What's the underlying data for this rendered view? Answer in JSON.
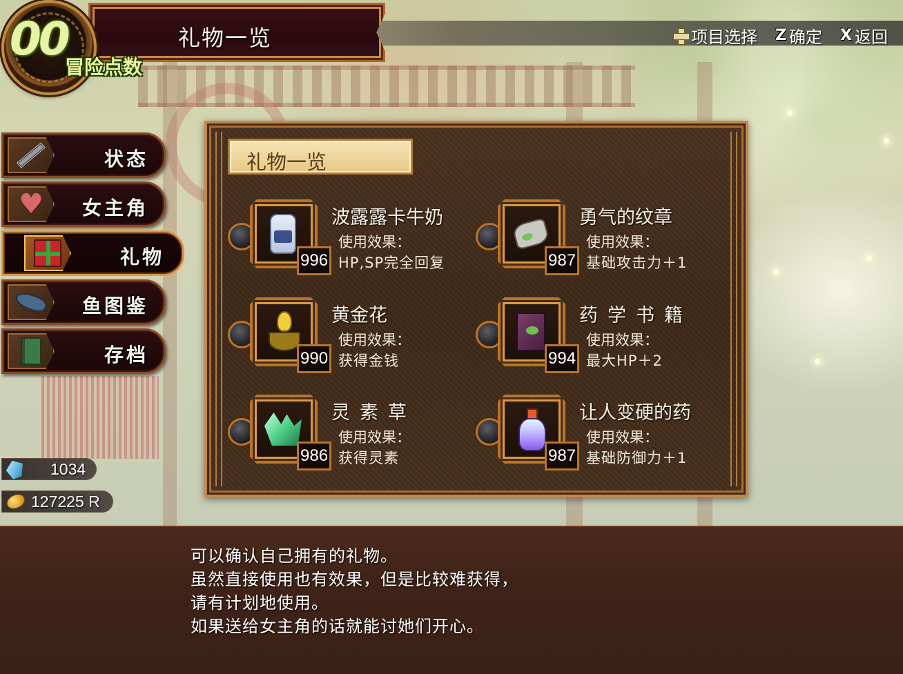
{
  "adventure": {
    "count": "00",
    "label": "冒险点数"
  },
  "header": {
    "title": "礼物一览"
  },
  "hints": {
    "select_label": "项目选择",
    "confirm_key": "Z",
    "confirm_label": "确定",
    "back_key": "X",
    "back_label": "返回"
  },
  "menu": [
    {
      "label": "状态",
      "icon": "sword-icon",
      "active": false
    },
    {
      "label": "女主角",
      "icon": "heart-icon",
      "active": false
    },
    {
      "label": "礼物",
      "icon": "gift-icon",
      "active": true
    },
    {
      "label": "鱼图鉴",
      "icon": "fish-icon",
      "active": false
    },
    {
      "label": "存档",
      "icon": "book-icon",
      "active": false
    }
  ],
  "resources": {
    "crystals": "1034",
    "money": "127225 R"
  },
  "panel": {
    "title": "礼物一览",
    "effect_label": "使用效果：",
    "items": [
      {
        "name": "波露露卡牛奶",
        "qty": "996",
        "effect": "HP,SP完全回复",
        "icon": "milk-bottle-icon"
      },
      {
        "name": "勇气的纹章",
        "qty": "987",
        "effect": "基础攻击力＋1",
        "icon": "emblem-icon"
      },
      {
        "name": "黄金花",
        "qty": "990",
        "effect": "获得金钱",
        "icon": "golden-flower-icon"
      },
      {
        "name": "药学书籍",
        "qty": "994",
        "effect": "最大HP＋2",
        "icon": "book-icon"
      },
      {
        "name": "灵素草",
        "qty": "986",
        "effect": "获得灵素",
        "icon": "crystal-herb-icon"
      },
      {
        "name": "让人变硬的药",
        "qty": "987",
        "effect": "基础防御力＋1",
        "icon": "potion-icon"
      }
    ]
  },
  "description": {
    "lines": [
      "可以确认自己拥有的礼物。",
      "虽然直接使用也有效果，但是比较难获得，",
      "请有计划地使用。",
      "如果送给女主角的话就能讨她们开心。"
    ]
  }
}
